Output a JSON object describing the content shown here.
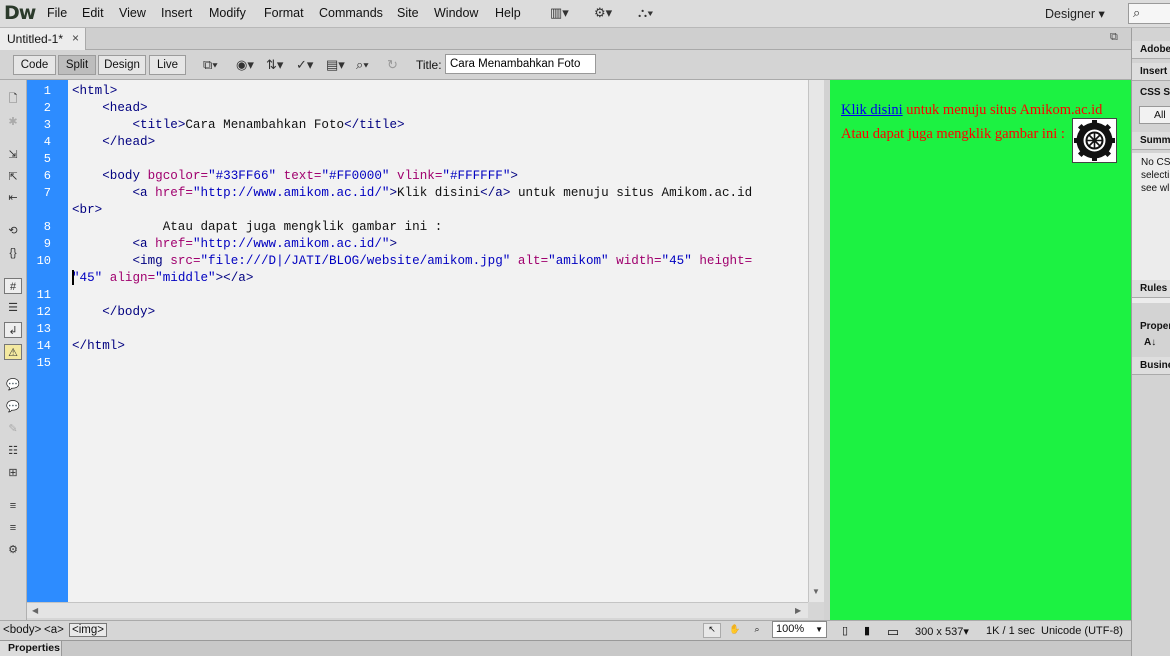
{
  "app": {
    "logo": "Dw"
  },
  "menu": [
    "File",
    "Edit",
    "View",
    "Insert",
    "Modify",
    "Format",
    "Commands",
    "Site",
    "Window",
    "Help"
  ],
  "menu_icons": {
    "layout": "▥▾",
    "gear": "⚙▾",
    "site": "⛬▾"
  },
  "workspace": "Designer ▾",
  "document_tab": {
    "label": "Untitled-1*",
    "close": "×"
  },
  "restore_glyph": "⧉",
  "toolbar": {
    "views": [
      "Code",
      "Split",
      "Design",
      "Live"
    ],
    "active_view": "Split",
    "title_label": "Title:",
    "title_value": "Cara Menambahkan Foto",
    "icons": {
      "multiscreen": "⧉▾",
      "preview": "◉▾",
      "file_manage": "⇅▾",
      "debug": "✓▾",
      "visual_aids": "▤▾",
      "check": "⌕▾",
      "refresh": "↻"
    }
  },
  "line_numbers": [
    "1",
    "2",
    "3",
    "4",
    "5",
    "6",
    "7",
    "",
    "8",
    "9",
    "10",
    "",
    "11",
    "12",
    "13",
    "14",
    "15"
  ],
  "code_lines": [
    [
      [
        "tag",
        "<html>"
      ]
    ],
    [
      [
        "txt",
        "    "
      ],
      [
        "tag",
        "<head>"
      ]
    ],
    [
      [
        "txt",
        "        "
      ],
      [
        "tag",
        "<title>"
      ],
      [
        "txt",
        "Cara Menambahkan Foto"
      ],
      [
        "tag",
        "</title>"
      ]
    ],
    [
      [
        "txt",
        "    "
      ],
      [
        "tag",
        "</head>"
      ]
    ],
    [],
    [
      [
        "txt",
        "    "
      ],
      [
        "tag",
        "<body "
      ],
      [
        "attr",
        "bgcolor="
      ],
      [
        "val",
        "\"#33FF66\""
      ],
      [
        "attr",
        " text="
      ],
      [
        "val",
        "\"#FF0000\""
      ],
      [
        "attr",
        " vlink="
      ],
      [
        "val",
        "\"#FFFFFF\""
      ],
      [
        "tag",
        ">"
      ]
    ],
    [
      [
        "txt",
        "        "
      ],
      [
        "tag",
        "<a "
      ],
      [
        "attr",
        "href="
      ],
      [
        "val",
        "\"http://www.amikom.ac.id/\""
      ],
      [
        "tag",
        ">"
      ],
      [
        "txt",
        "Klik disini"
      ],
      [
        "tag",
        "</a>"
      ],
      [
        "txt",
        " untuk menuju situs Amikom.ac.id"
      ]
    ],
    [
      [
        "tag",
        "<br>"
      ]
    ],
    [
      [
        "txt",
        "            Atau dapat juga mengklik gambar ini :"
      ]
    ],
    [
      [
        "txt",
        "        "
      ],
      [
        "tag",
        "<a "
      ],
      [
        "attr",
        "href="
      ],
      [
        "val",
        "\"http://www.amikom.ac.id/\""
      ],
      [
        "tag",
        ">"
      ]
    ],
    [
      [
        "txt",
        "        "
      ],
      [
        "tag",
        "<img "
      ],
      [
        "attr",
        "src="
      ],
      [
        "val",
        "\"file:///D|/JATI/BLOG/website/amikom.jpg\""
      ],
      [
        "attr",
        " alt="
      ],
      [
        "val",
        "\"amikom\""
      ],
      [
        "attr",
        " width="
      ],
      [
        "val",
        "\"45\""
      ],
      [
        "attr",
        " height="
      ]
    ],
    [
      [
        "val",
        "\"45\""
      ],
      [
        "attr",
        " align="
      ],
      [
        "val",
        "\"middle\""
      ],
      [
        "tag",
        "></a>"
      ]
    ],
    [],
    [
      [
        "txt",
        "    "
      ],
      [
        "tag",
        "</body>"
      ]
    ],
    [],
    [
      [
        "tag",
        "</html>"
      ]
    ],
    []
  ],
  "design_view": {
    "bg": "#33FF66",
    "text_color": "#FF0000",
    "link_text": "Klik disini",
    "after_link": " untuk menuju situs Amikom.ac.id",
    "line2": "Atau dapat juga mengklik gambar ini :"
  },
  "status": {
    "tags": [
      "<body>",
      "<a>",
      "<img>"
    ],
    "zoom": "100%",
    "window_size": "300 x 537▾",
    "download": "1K / 1 sec",
    "encoding": "Unicode (UTF-8)",
    "tools": {
      "select": "↖",
      "hand": "✋",
      "zoom_tool": "⌕"
    },
    "sizes": {
      "phone": "▯",
      "tablet": "▮",
      "desktop": "▭"
    }
  },
  "properties_tab": "Properties",
  "right_panel": {
    "adobe": "Adobe",
    "insert": "Insert",
    "css": "CSS St",
    "all": "All",
    "summary": "Summa",
    "no_css": [
      "No CS",
      "selecti",
      "see wl"
    ],
    "rules": "Rules",
    "properties": "Proper",
    "az": "A↓",
    "business": "Busine"
  },
  "left_tool_icons": [
    "🗋",
    "✱",
    "⇲",
    "⇱",
    "⇤",
    "⟲",
    "{}",
    "#",
    "☰",
    "↲",
    "⚠",
    "💬",
    "💬",
    "✎",
    "☷",
    "⊞",
    "≡",
    "≡",
    "⚙"
  ]
}
